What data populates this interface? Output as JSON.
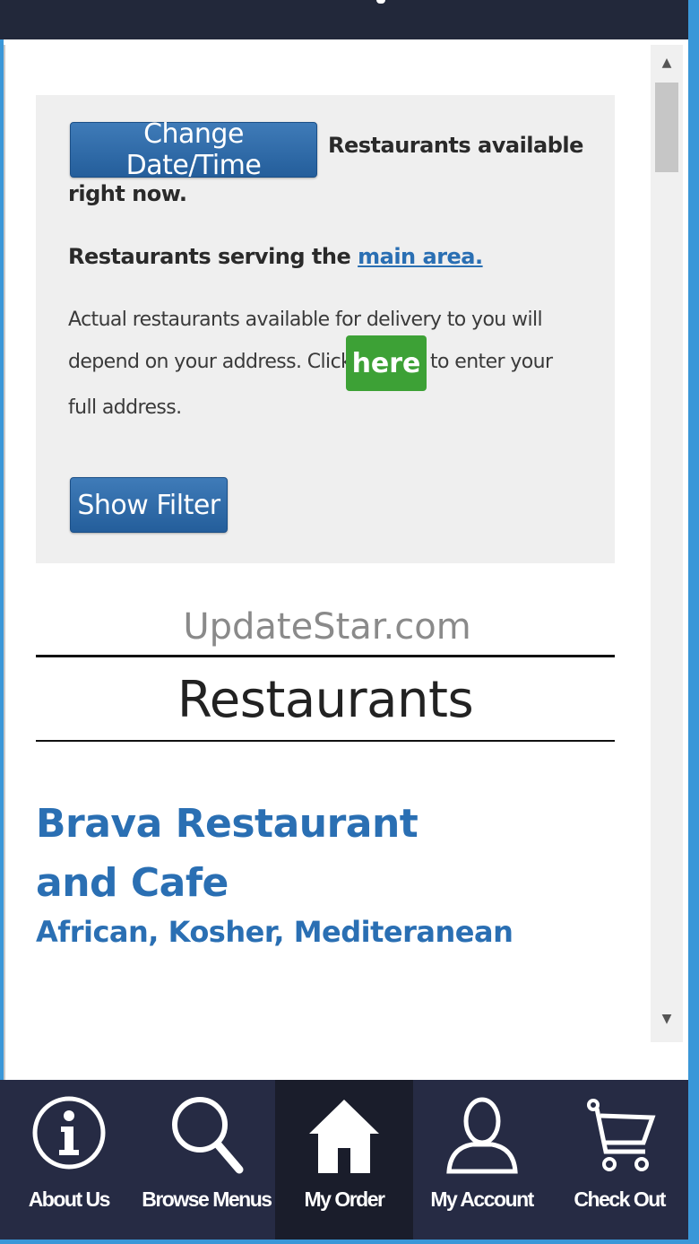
{
  "info": {
    "change_button": "Change Date/Time",
    "available_line1": "Restaurants available",
    "available_line2": "right now.",
    "serving_prefix": "Restaurants serving the",
    "serving_link": "main area.",
    "actual_line1": "Actual restaurants available for delivery to you will",
    "actual_line2": "depend on your address. Click",
    "here_button": "here",
    "actual_line3": "to enter your",
    "actual_line4": "full address.",
    "filter_button": "Show Filter"
  },
  "watermark": "UpdateStar.com",
  "section_title": "Restaurants",
  "restaurant": {
    "name": "Brava Restaurant and Cafe",
    "cuisine": "African, Kosher, Mediteranean"
  },
  "nav": [
    {
      "label": "About Us",
      "icon": "info-icon"
    },
    {
      "label": "Browse Menus",
      "icon": "search-icon"
    },
    {
      "label": "My Order",
      "icon": "home-icon"
    },
    {
      "label": "My Account",
      "icon": "user-icon"
    },
    {
      "label": "Check Out",
      "icon": "cart-icon"
    }
  ],
  "colors": {
    "accent_blue": "#245e9b",
    "link_blue": "#2a6fb3",
    "here_green": "#3da136",
    "navbar": "#262b44"
  }
}
